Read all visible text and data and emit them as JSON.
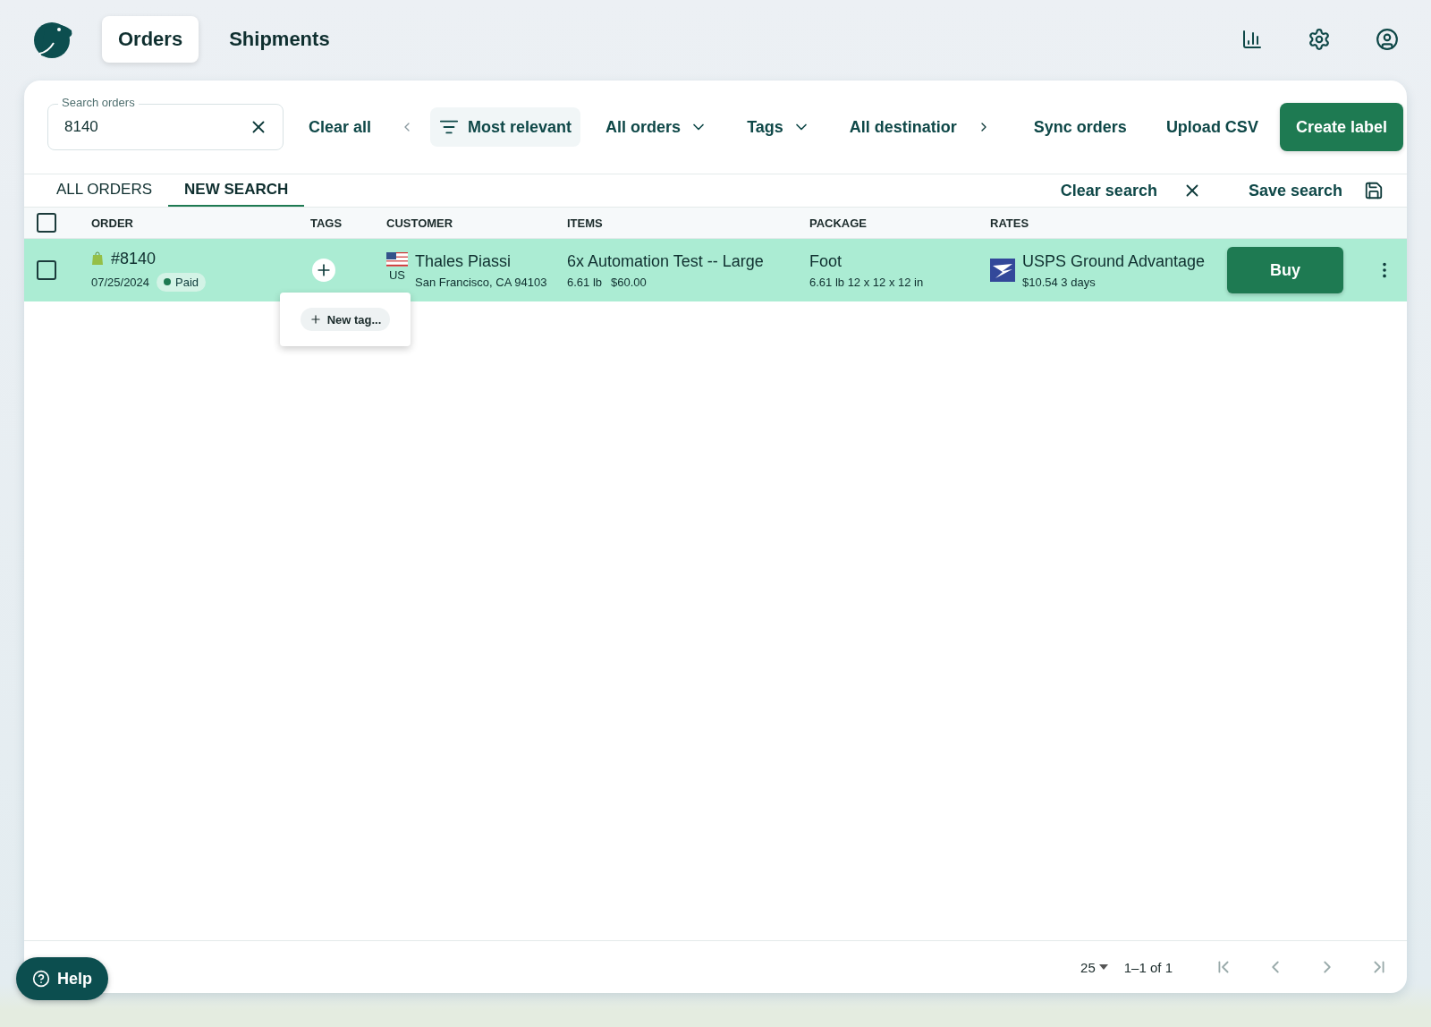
{
  "nav": {
    "tabs": [
      {
        "label": "Orders",
        "selected": true
      },
      {
        "label": "Shipments",
        "selected": false
      }
    ]
  },
  "toolbar": {
    "search": {
      "label": "Search orders",
      "value": "8140"
    },
    "clear_all": "Clear all",
    "sort": "Most relevant",
    "filters": [
      "All orders",
      "Tags",
      "All destinatior"
    ],
    "actions": [
      "Sync orders",
      "Upload CSV"
    ],
    "primary": "Create label"
  },
  "view_tabs": [
    {
      "label": "ALL ORDERS",
      "selected": false
    },
    {
      "label": "NEW SEARCH",
      "selected": true
    }
  ],
  "clear_search": "Clear search",
  "save_search": "Save search",
  "table": {
    "select_all": false,
    "columns": [
      "ORDER",
      "TAGS",
      "CUSTOMER",
      "ITEMS",
      "PACKAGE",
      "RATES"
    ],
    "rows": [
      {
        "checked": false,
        "highlighted": true,
        "order": "#8140",
        "date": "07/25/2024",
        "status": "Paid",
        "customer": "Thales Piassi",
        "country": "US",
        "address": "San Francisco, CA 94103",
        "items": "6x Automation Test -- Large",
        "weight": "6.61 lb",
        "price": "$60.00",
        "package": "Foot",
        "package_detail": "6.61 lb 12 x 12 x 12 in",
        "rate": "USPS Ground Advantage",
        "rate_detail": "$10.54 3 days",
        "action": "Buy"
      }
    ]
  },
  "tag_popup": {
    "open": true,
    "new_tag": "New tag..."
  },
  "pagination": {
    "per_page": "25",
    "range": "1–1 of 1"
  },
  "help": "Help"
}
